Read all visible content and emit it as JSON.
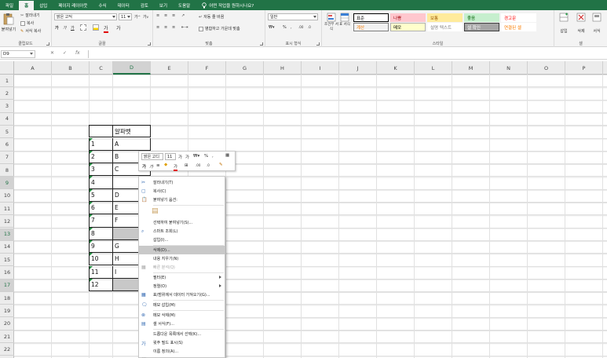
{
  "tabs": [
    "파일",
    "홈",
    "삽입",
    "페이지 레이아웃",
    "수식",
    "데이터",
    "검토",
    "보기",
    "도움말"
  ],
  "tell_me": "어떤 작업을 원하시나요?",
  "ribbon": {
    "clipboard": {
      "paste": "붙여넣기",
      "cut": "잘라내기",
      "copy": "복사",
      "format_painter": "서식 복사",
      "label": "클립보드"
    },
    "font": {
      "name": "맑은 고딕",
      "size": "11",
      "bold": "가",
      "italic": "가",
      "underline": "가",
      "phonetic": "가",
      "label": "글꼴"
    },
    "alignment": {
      "wrap": "자동 줄 바꿈",
      "merge": "병합하고 가운데 맞춤",
      "label": "맞춤"
    },
    "number": {
      "format": "일반",
      "percent": "%",
      "comma": ",",
      "label": "표시 형식"
    },
    "styles": {
      "conditional": "조건부 서식",
      "table": "표 서식",
      "cells": [
        {
          "text": "표준",
          "bg": "#ffffff",
          "fg": "#000000",
          "border": "#000000"
        },
        {
          "text": "나쁨",
          "bg": "#ffc7ce",
          "fg": "#9c0006",
          "border": "#ffc7ce"
        },
        {
          "text": "보통",
          "bg": "#ffeb9c",
          "fg": "#9c5700",
          "border": "#ffeb9c"
        },
        {
          "text": "좋음",
          "bg": "#c6efce",
          "fg": "#006100",
          "border": "#c6efce"
        },
        {
          "text": "경고문",
          "bg": "#ffffff",
          "fg": "#ff0000",
          "border": "#ffffff"
        },
        {
          "text": "계산",
          "bg": "#f2f2f2",
          "fg": "#fa7d00",
          "border": "#7f7f7f"
        },
        {
          "text": "메모",
          "bg": "#ffffcc",
          "fg": "#000000",
          "border": "#b2b2b2"
        },
        {
          "text": "설명 텍스트",
          "bg": "#ffffff",
          "fg": "#7f7f7f",
          "border": "#ffffff"
        },
        {
          "text": "셀 확인",
          "bg": "#a5a5a5",
          "fg": "#ffffff",
          "border": "#3f3f3f"
        },
        {
          "text": "연결된 셀",
          "bg": "#ffffff",
          "fg": "#fa7d00",
          "border": "#ffffff"
        }
      ],
      "label": "스타일"
    },
    "cells": {
      "insert": "삽입",
      "delete": "삭제",
      "format": "서식",
      "label": "셀"
    }
  },
  "formula_bar": {
    "name_box": "D9",
    "cancel": "✕",
    "enter": "✓",
    "fx": "fx",
    "value": ""
  },
  "columns": [
    "A",
    "B",
    "C",
    "D",
    "E",
    "F",
    "G",
    "H",
    "I",
    "J",
    "K",
    "L",
    "M",
    "N",
    "O",
    "P"
  ],
  "selected_column": "D",
  "rows": [
    "1",
    "2",
    "3",
    "4",
    "5",
    "6",
    "7",
    "8",
    "9",
    "10",
    "11",
    "12",
    "13",
    "14",
    "15",
    "16",
    "17",
    "18",
    "19",
    "20",
    "21",
    "22"
  ],
  "selected_rows": [
    "9",
    "13",
    "17"
  ],
  "table": {
    "header": "알파벳",
    "rows": [
      {
        "c": "1",
        "d": "A",
        "gray": false
      },
      {
        "c": "2",
        "d": "B",
        "gray": false
      },
      {
        "c": "3",
        "d": "C",
        "gray": false
      },
      {
        "c": "4",
        "d": "",
        "gray": false
      },
      {
        "c": "5",
        "d": "D",
        "gray": false
      },
      {
        "c": "6",
        "d": "E",
        "gray": false
      },
      {
        "c": "7",
        "d": "F",
        "gray": false
      },
      {
        "c": "8",
        "d": "",
        "gray": true
      },
      {
        "c": "9",
        "d": "G",
        "gray": false
      },
      {
        "c": "10",
        "d": "H",
        "gray": false
      },
      {
        "c": "11",
        "d": "I",
        "gray": false
      },
      {
        "c": "12",
        "d": "",
        "gray": true
      }
    ]
  },
  "mini_toolbar": {
    "font": "맑은 고디",
    "size": "11",
    "percent": "%"
  },
  "context_menu": [
    {
      "label": "잘라내기(T)",
      "icon": "scissors-icon",
      "state": "normal"
    },
    {
      "label": "복사(C)",
      "icon": "copy-icon",
      "state": "normal"
    },
    {
      "label": "붙여넣기 옵션:",
      "icon": "paste-icon",
      "state": "normal"
    },
    {
      "label": "",
      "icon": "paste-option-icon",
      "state": "normal"
    },
    {
      "label": "선택하여 붙여넣기(S)...",
      "icon": "",
      "state": "normal"
    },
    {
      "label": "스마트 조회(L)",
      "icon": "search-icon",
      "state": "normal"
    },
    {
      "label": "삽입(I)...",
      "icon": "",
      "state": "normal"
    },
    {
      "label": "삭제(D)...",
      "icon": "",
      "state": "highlight"
    },
    {
      "label": "내용 지우기(N)",
      "icon": "",
      "state": "normal"
    },
    {
      "label": "빠른 분석(Q)",
      "icon": "quick-analysis-icon",
      "state": "disabled"
    },
    {
      "label": "필터(E)",
      "icon": "",
      "state": "submenu"
    },
    {
      "label": "정렬(O)",
      "icon": "",
      "state": "submenu"
    },
    {
      "label": "표/범위에서 데이터 가져오기(G)...",
      "icon": "table-icon",
      "state": "normal"
    },
    {
      "label": "메모 삽입(M)",
      "icon": "comment-icon",
      "state": "normal"
    },
    {
      "label": "메모 삭제(M)",
      "icon": "comment-delete-icon",
      "state": "normal"
    },
    {
      "label": "셀 서식(F)...",
      "icon": "format-cells-icon",
      "state": "normal"
    },
    {
      "label": "드롭다운 목록에서 선택(K)...",
      "icon": "",
      "state": "normal"
    },
    {
      "label": "윗주 필드 표시(S)",
      "icon": "phonetic-icon",
      "state": "normal"
    },
    {
      "label": "이름 정의(A)...",
      "icon": "",
      "state": "normal"
    },
    {
      "label": "링크(I)",
      "icon": "link-icon",
      "state": "disabled"
    }
  ],
  "colors": {
    "accent": "#217346",
    "ribbon_bg": "#f3f3f3",
    "menu_highlight": "#c9c9c9",
    "selected_cell_fill": "#c8c8c8"
  }
}
